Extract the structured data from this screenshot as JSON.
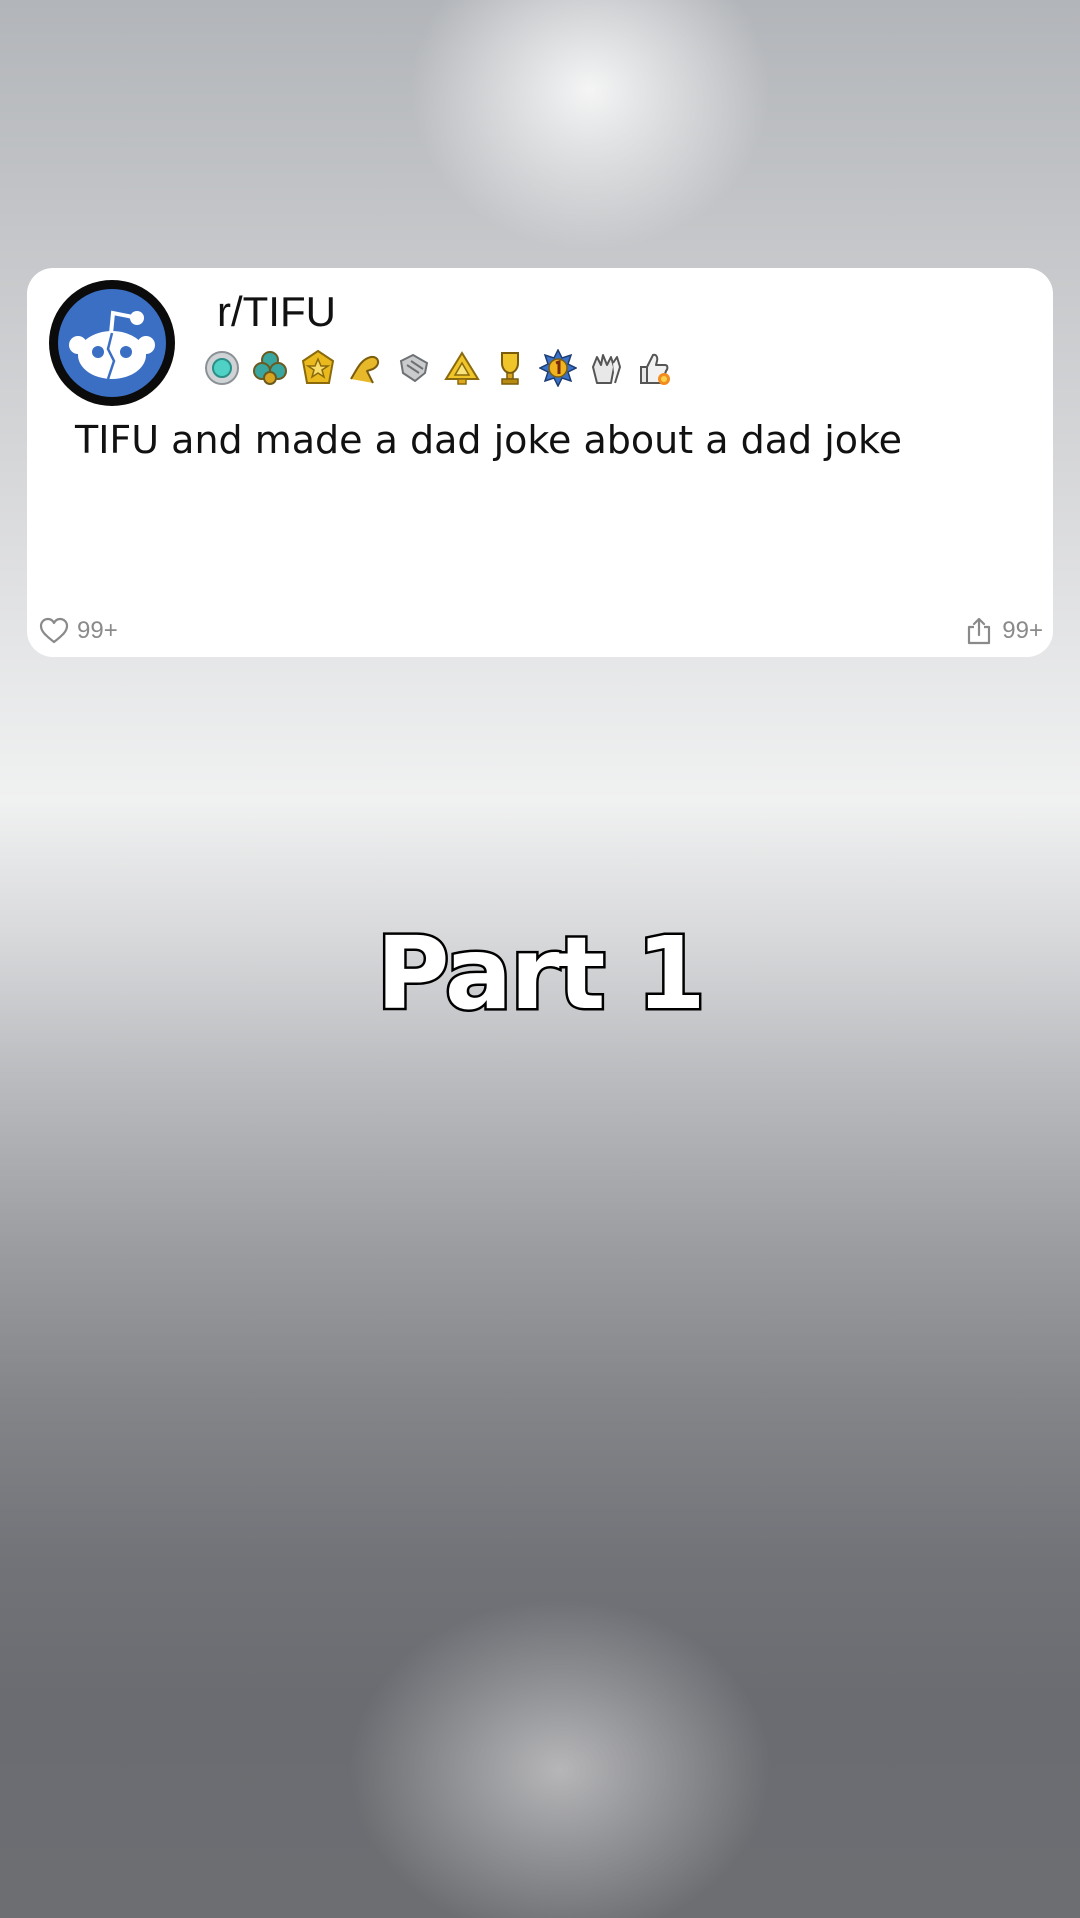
{
  "post": {
    "subreddit": "r/TIFU",
    "title": "TIFU and made a dad joke about a dad joke",
    "avatar_icon": "reddit-snoo-icon",
    "awards": [
      "silver-award-icon",
      "clover-award-icon",
      "gold-star-award-icon",
      "gold-hand-award-icon",
      "silver-handshake-award-icon",
      "gold-pyramid-award-icon",
      "gold-trophy-award-icon",
      "number-one-award-icon",
      "clapping-hands-award-icon",
      "thumbs-up-award-icon"
    ],
    "likes": "99+",
    "shares": "99+"
  },
  "overlay": {
    "part_label": "Part 1"
  },
  "colors": {
    "card_background": "#ffffff",
    "avatar_blue": "#3a6fc4",
    "action_gray": "#8a8a8a",
    "title_text": "#111111"
  }
}
